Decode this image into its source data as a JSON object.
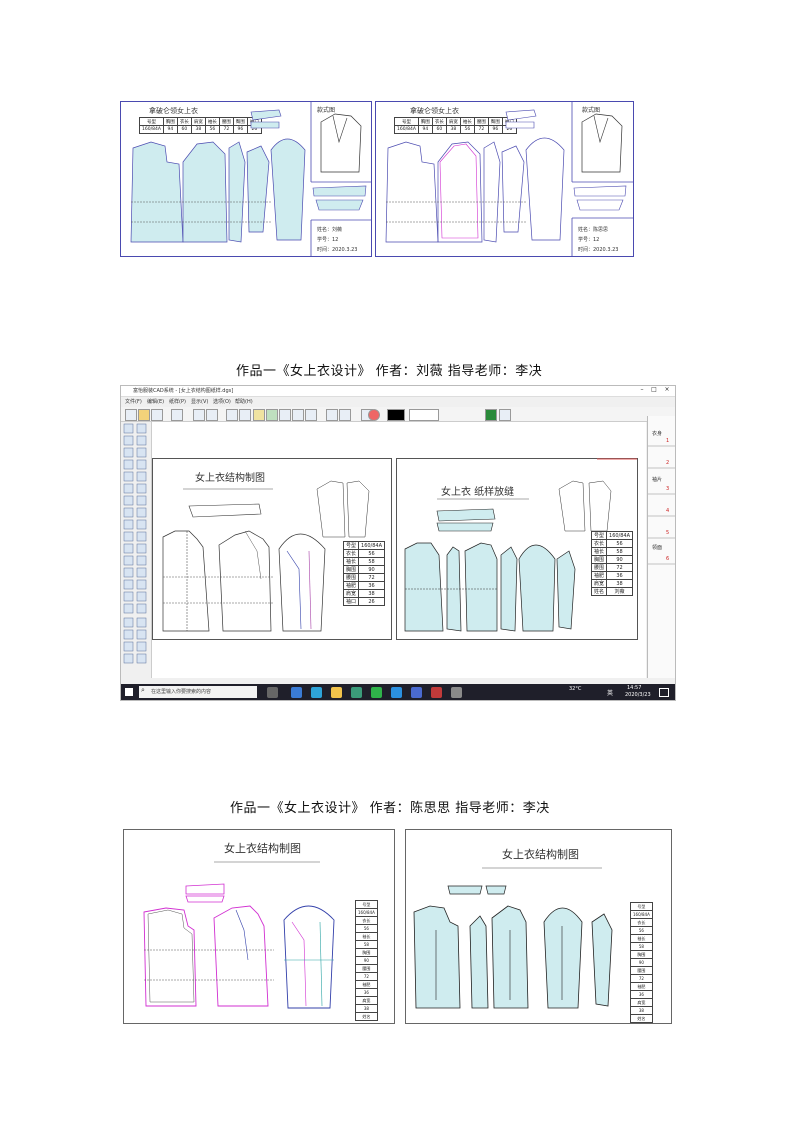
{
  "top_panels": [
    {
      "title": "拿破仑领女上衣",
      "style_label": "款式图",
      "table_head": [
        "号型",
        "胸围",
        "衣长",
        "肩宽",
        "袖长",
        "腰围",
        "臀围",
        "袖口"
      ],
      "table_row": [
        "160/84A",
        "94",
        "60",
        "38",
        "56",
        "72",
        "96",
        "26"
      ],
      "info_name": "姓名：刘薇",
      "info_number": "学号：12",
      "info_date": "时间：2020.3.23"
    },
    {
      "title": "拿破仑领女上衣",
      "style_label": "款式图",
      "table_head": [
        "号型",
        "胸围",
        "衣长",
        "肩宽",
        "袖长",
        "腰围",
        "臀围",
        "袖口"
      ],
      "table_row": [
        "160/84A",
        "94",
        "60",
        "38",
        "56",
        "72",
        "96",
        "26"
      ],
      "info_name": "姓名：陈思思",
      "info_number": "学号：12",
      "info_date": "时间：2020.3.23"
    }
  ],
  "caption1": "作品一《女上衣设计》 作者：刘薇 指导老师：李决",
  "cad": {
    "window_title": "富怡服装CAD系统 - [女上衣结构图纸样.dgs]",
    "menu": [
      "文件(F)",
      "编辑(E)",
      "纸样(P)",
      "显示(V)",
      "选项(O)",
      "帮助(H)"
    ],
    "left_title": "女上衣结构制图",
    "right_title": "女上衣 纸样放缝",
    "spec_rows": [
      [
        "号型",
        "160/84A"
      ],
      [
        "衣长",
        "56"
      ],
      [
        "袖长",
        "58"
      ],
      [
        "胸围",
        "90"
      ],
      [
        "腰围",
        "72"
      ],
      [
        "袖肥",
        "36"
      ],
      [
        "肩宽",
        "38"
      ],
      [
        "袖口",
        "26"
      ]
    ],
    "spec_rows_r": [
      [
        "号型",
        "160/84A"
      ],
      [
        "衣长",
        "56"
      ],
      [
        "袖长",
        "58"
      ],
      [
        "胸围",
        "90"
      ],
      [
        "腰围",
        "72"
      ],
      [
        "袖肥",
        "36"
      ],
      [
        "肩宽",
        "38"
      ],
      [
        "姓名",
        "刘薇"
      ]
    ],
    "side_labels": [
      "衣身",
      "1",
      "2",
      "袖片",
      "3",
      "4",
      "5",
      "领面",
      "6"
    ],
    "search_placeholder": "在这里输入你要搜索的内容",
    "weather": "32°C",
    "tray_lang": "英",
    "time": "14:57",
    "date": "2020/3/23"
  },
  "caption2": "作品一《女上衣设计》 作者：陈思思 指导老师：李决",
  "bottom_panels": [
    {
      "title": "女上衣结构制图",
      "spec": [
        "号型",
        "160/84A",
        "衣长",
        "56",
        "袖长",
        "58",
        "胸围",
        "90",
        "腰围",
        "72",
        "袖肥",
        "36",
        "肩宽",
        "38",
        "姓名"
      ]
    },
    {
      "title": "女上衣结构制图",
      "spec": [
        "号型",
        "160/84A",
        "衣长",
        "56",
        "袖长",
        "58",
        "胸围",
        "90",
        "腰围",
        "72",
        "袖肥",
        "36",
        "肩宽",
        "38",
        "姓名"
      ]
    }
  ],
  "colors": {
    "panel_border": "#4a4ab0",
    "fill_blue": "#cfecef",
    "magenta": "#d12fd1",
    "taskbar": "#1f1f2a"
  }
}
